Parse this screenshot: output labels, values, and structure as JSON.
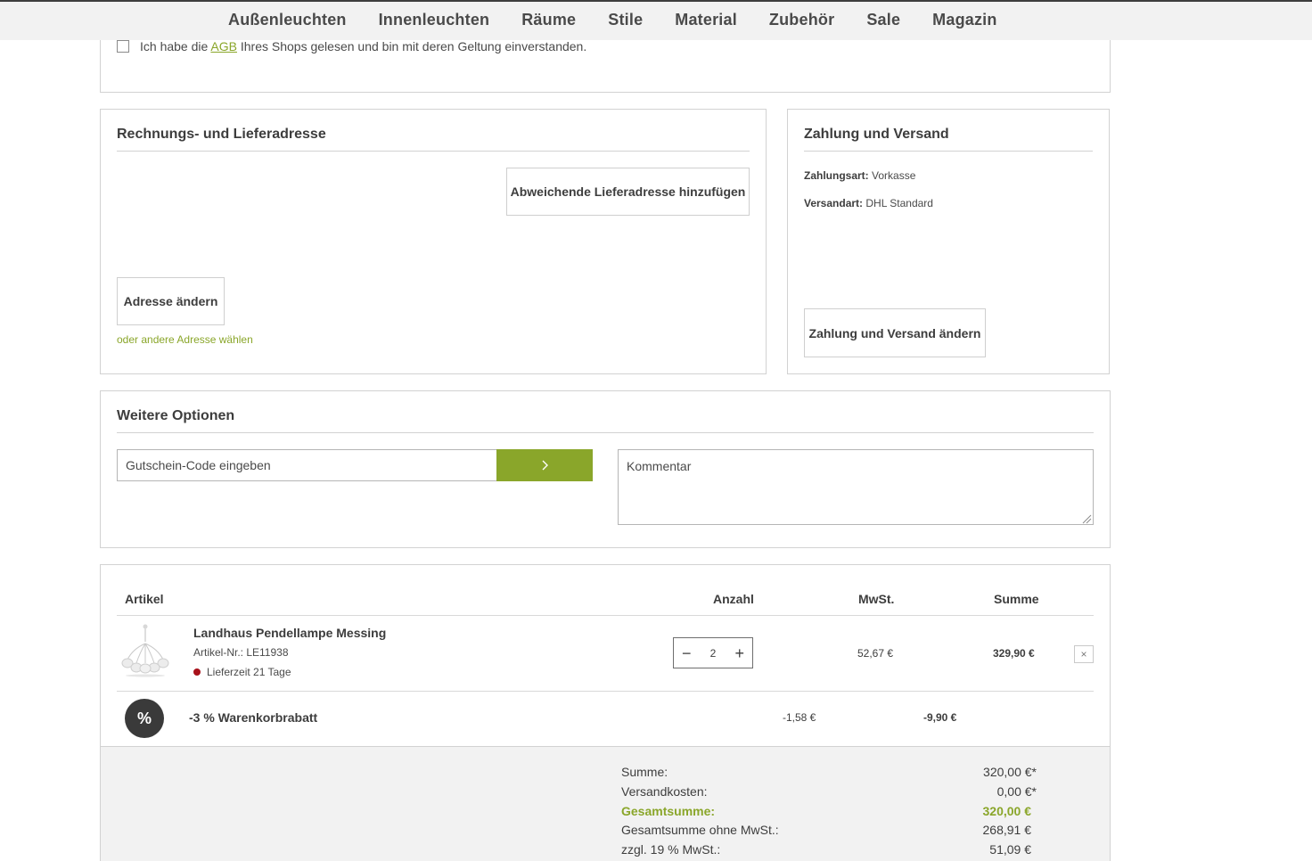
{
  "nav": {
    "items": [
      "Außenleuchten",
      "Innenleuchten",
      "Räume",
      "Stile",
      "Material",
      "Zubehör",
      "Sale",
      "Magazin"
    ]
  },
  "agb": {
    "text_before": "Ich habe die ",
    "link": "AGB",
    "text_after": " Ihres Shops gelesen und bin mit deren Geltung einverstanden."
  },
  "address": {
    "title": "Rechnungs- und Lieferadresse",
    "add_delivery_button": "Abweichende Lieferadresse hinzufügen",
    "change_button": "Adresse ändern",
    "other_link": "oder andere Adresse wählen"
  },
  "payment": {
    "title": "Zahlung und Versand",
    "payment_label": "Zahlungsart:",
    "payment_value": "Vorkasse",
    "shipping_label": "Versandart:",
    "shipping_value": "DHL Standard",
    "change_button": "Zahlung und Versand ändern"
  },
  "options": {
    "title": "Weitere Optionen",
    "voucher_placeholder": "Gutschein-Code eingeben",
    "voucher_submit_icon": "chevron-right-icon",
    "comment_placeholder": "Kommentar"
  },
  "cart": {
    "headers": {
      "article": "Artikel",
      "qty": "Anzahl",
      "tax": "MwSt.",
      "sum": "Summe"
    },
    "item": {
      "name": "Landhaus Pendellampe Messing",
      "sku": "Artikel-Nr.: LE11938",
      "delivery": "Lieferzeit 21 Tage",
      "qty": "2",
      "tax": "52,67 €",
      "sum": "329,90 €",
      "minus": "−",
      "plus": "+",
      "remove": "×"
    },
    "discount": {
      "badge": "%",
      "label": "-3 % Warenkorbrabatt",
      "tax": "-1,58 €",
      "sum": "-9,90 €"
    }
  },
  "totals": {
    "subtotal_label": "Summe:",
    "subtotal_value": "320,00 €*",
    "shipping_label": "Versandkosten:",
    "shipping_value": "0,00 €*",
    "grand_label": "Gesamtsumme:",
    "grand_value": "320,00 €",
    "net_label": "Gesamtsumme ohne MwSt.:",
    "net_value": "268,91 €",
    "vat_label": "zzgl. 19 % MwSt.:",
    "vat_value": "51,09 €"
  },
  "colors": {
    "accent": "#8aa62a",
    "dark": "#3d3d3d",
    "delivery_dot": "#a8121b"
  }
}
